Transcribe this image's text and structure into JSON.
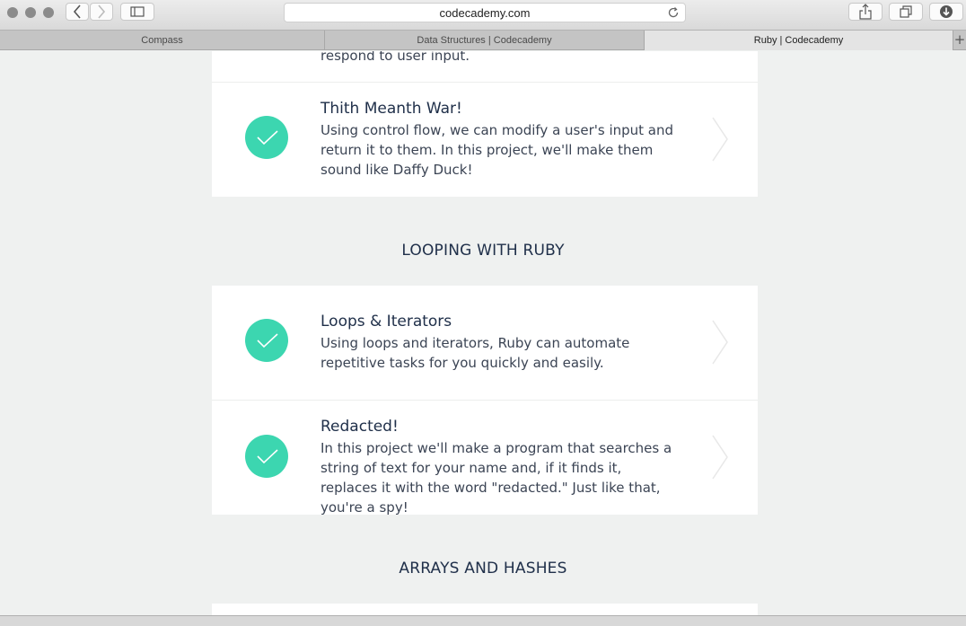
{
  "browser": {
    "url": "codecademy.com",
    "tabs": [
      {
        "label": "Compass"
      },
      {
        "label": "Data Structures | Codecademy"
      },
      {
        "label": "Ruby | Codecademy"
      }
    ],
    "new_tab": "+"
  },
  "page": {
    "partial_text": "respond to user input.",
    "rows": [
      {
        "title": "Thith Meanth War!",
        "description": "Using control flow, we can modify a user's input and return it to them. In this project, we'll make them sound like Daffy Duck!"
      },
      {
        "title": "Loops & Iterators",
        "description": "Using loops and iterators, Ruby can automate repetitive tasks for you quickly and easily."
      },
      {
        "title": "Redacted!",
        "description": "In this project we'll make a program that searches a string of text for your name and, if it finds it, replaces it with the word \"redacted.\" Just like that, you're a spy!"
      }
    ],
    "sections": [
      {
        "heading": "LOOPING WITH RUBY"
      },
      {
        "heading": "ARRAYS AND HASHES"
      }
    ]
  },
  "colors": {
    "accent": "#3cd6b0",
    "background": "#eff1f0",
    "title": "#20304a"
  }
}
